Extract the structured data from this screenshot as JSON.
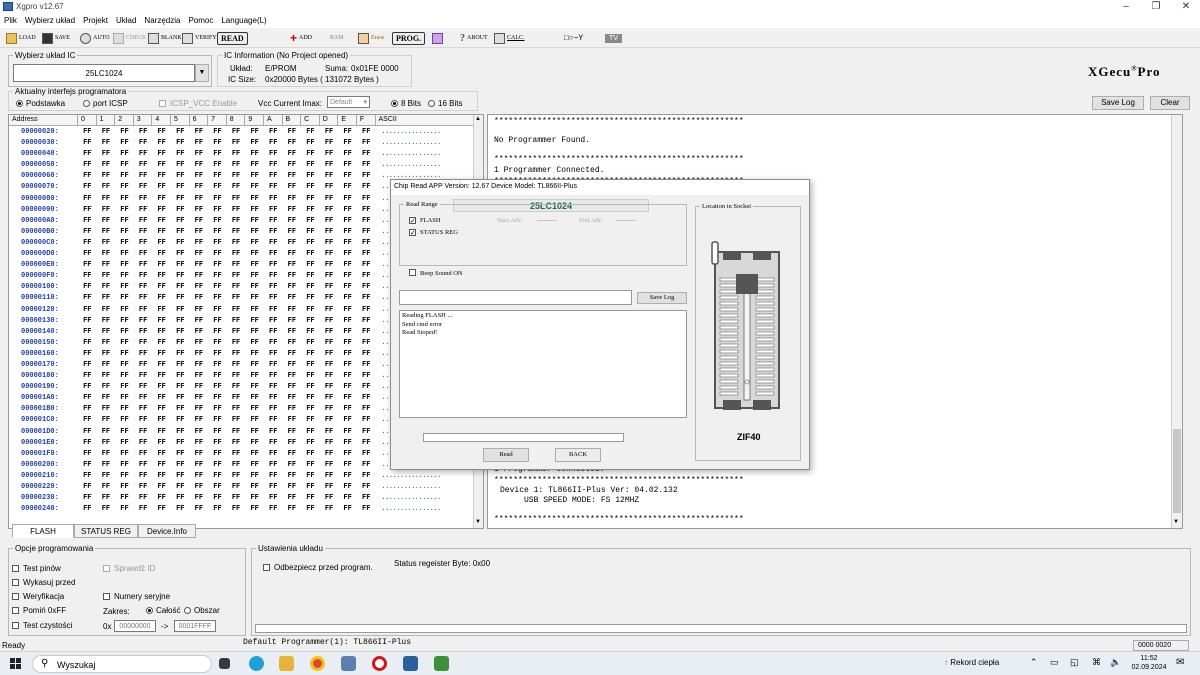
{
  "window": {
    "title": "Xgpro v12.67"
  },
  "menu": [
    "Plik",
    "Wybierz układ",
    "Projekt",
    "Układ",
    "Narzędzia",
    "Pomoc",
    "Language(L)"
  ],
  "toolbar": {
    "load": "LOAD",
    "save": "SAVE",
    "auto": "AUTO",
    "check": "CHECK",
    "blank": "BLANK",
    "verify": "VERIFY",
    "read": "READ",
    "add": "ADD",
    "ram": "RAM",
    "erase": "Erase",
    "prog": "PROG.",
    "about": "ABOUT",
    "calc": "CALC.",
    "tv": "TV"
  },
  "brand": "XGecu",
  "brand_suffix": "Pro",
  "select_ic": {
    "legend": "Wybierz układ IC",
    "value": "25LC1024"
  },
  "ic_info": {
    "legend": "IC Information (No Project opened)",
    "uklad_label": "Układ:",
    "uklad_value": "E/PROM",
    "suma_label": "Suma:",
    "suma_value": "0x01FE 0000",
    "size_label": "IC Size:",
    "size_value": "0x20000 Bytes ( 131072 Bytes )"
  },
  "interface": {
    "legend": "Aktualny interfejs programatora",
    "podstawka": "Podstawka",
    "icsp": "port ICSP",
    "icsp_vcc": "ICSP_VCC Enable",
    "vcc_label": "Vcc Current Imax:",
    "vcc_value": "Default",
    "bits8": "8 Bits",
    "bits16": "16 Bits"
  },
  "buttons": {
    "save_log": "Save Log",
    "clear": "Clear"
  },
  "hex": {
    "headers": [
      "Address",
      "0",
      "1",
      "2",
      "3",
      "4",
      "5",
      "6",
      "7",
      "8",
      "9",
      "A",
      "B",
      "C",
      "D",
      "E",
      "F",
      "ASCII"
    ],
    "addresses": [
      "00000020:",
      "00000030:",
      "00000040:",
      "00000050:",
      "00000060:",
      "00000070:",
      "00000080:",
      "00000090:",
      "000000A0:",
      "000000B0:",
      "000000C0:",
      "000000D0:",
      "000000E0:",
      "000000F0:",
      "00000100:",
      "00000110:",
      "00000120:",
      "00000130:",
      "00000140:",
      "00000150:",
      "00000160:",
      "00000170:",
      "00000180:",
      "00000190:",
      "000001A0:",
      "000001B0:",
      "000001C0:",
      "000001D0:",
      "000001E0:",
      "000001F0:",
      "00000200:",
      "00000210:",
      "00000220:",
      "00000230:",
      "00000240:"
    ],
    "byte": "FF",
    "ascii": "................"
  },
  "log": {
    "stars": "****************************************************",
    "no_programmer": "No Programmer Found.",
    "connected": "1 Programmer Connected.",
    "device": "Device 1: TL866II-Plus Ver: 04.02.132",
    "speed": "USB SPEED MODE: FS 12MHZ"
  },
  "tabs": [
    "FLASH",
    "STATUS REG",
    "Device.Info"
  ],
  "dialog": {
    "title": "Chip Read   APP Version: 12.67 Device Model: TL866II-Plus",
    "chip": "25LC1024",
    "read_range": "Read Range",
    "flash": "FLASH",
    "status_reg": "STATUS REG",
    "start_adr": "Start Adr:",
    "end_adr": "End Adr:",
    "dashes": "---------",
    "beep": "Beep Sound ON",
    "save_log": "Save Log",
    "messages": [
      "Reading FLASH ...",
      "Send cmd error",
      "Read Stoped!"
    ],
    "read_btn": "Read",
    "back_btn": "BACK",
    "socket_legend": "Location in Socket",
    "zif": "ZIF40"
  },
  "options": {
    "legend": "Opcje programowania",
    "test_pinow": "Test pinów",
    "sprawdz_id": "Sprawdź ID",
    "wykasuj": "Wykasuj przed",
    "weryfikacja": "Weryfikacja",
    "numery": "Numery seryjne",
    "pomin": "Pomiń 0xFF",
    "zakres": "Zakres:",
    "calosc": "Całość",
    "obszar": "Obszar",
    "test_czystosci": "Test czystości",
    "range_from": "00000000",
    "range_arrow": "->",
    "range_to": "0001FFFF",
    "prefix": "0x"
  },
  "settings": {
    "legend": "Ustawienia układu",
    "odbezpiecz": "Odbezpiecz przed program.",
    "status_byte": "Status regeister Byte: 0x00"
  },
  "status": {
    "ready": "Ready",
    "default_prog": "Default Programmer(1): TL866II-Plus",
    "addr": "0000 0020"
  },
  "taskbar": {
    "search": "Wyszukaj",
    "weather": "Rekord ciepła",
    "time": "11:52",
    "date": "02.09.2024"
  },
  "colors": {
    "addr_blue": "#1f3fb0",
    "chip_green": "#1d6b3e",
    "socket_dark": "#555555"
  }
}
